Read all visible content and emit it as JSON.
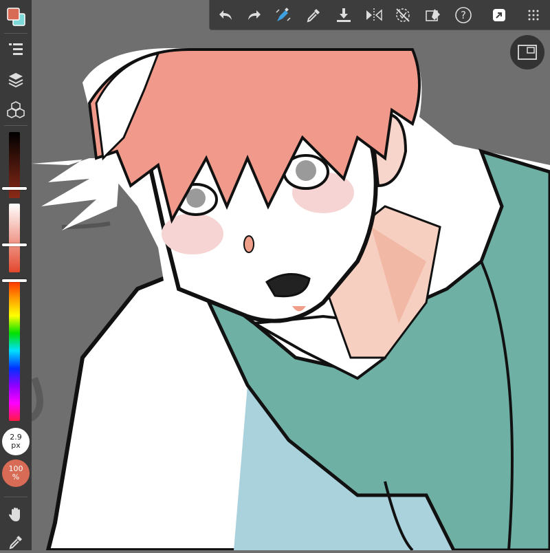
{
  "app": {
    "accent_color": "#d86b55",
    "secondary_color": "#7fd8d8"
  },
  "left_toolbar": {
    "items": [
      {
        "name": "color-swatch",
        "icon": "primary-secondary-color-swatch"
      },
      {
        "name": "menu",
        "icon": "menu-list-icon"
      },
      {
        "name": "layers",
        "icon": "layers-icon"
      },
      {
        "name": "materials",
        "icon": "cubes-icon"
      }
    ],
    "brush_size": {
      "value": "2.9",
      "unit": "px"
    },
    "brush_opacity": {
      "value": "100",
      "unit": "%"
    },
    "bottom_tools": [
      {
        "name": "hand",
        "icon": "hand-icon"
      },
      {
        "name": "eyedropper",
        "icon": "eyedropper-icon"
      }
    ],
    "sliders": {
      "brightness_level": 0.85,
      "saturation_level": 0.6,
      "hue_level": 0.0
    }
  },
  "top_toolbar": {
    "tools": [
      {
        "name": "undo",
        "icon": "undo-icon"
      },
      {
        "name": "redo",
        "icon": "redo-icon"
      },
      {
        "name": "fill-transform",
        "icon": "pen-transform-icon"
      },
      {
        "name": "eyedropper",
        "icon": "eyedropper-icon"
      },
      {
        "name": "save",
        "icon": "download-save-icon"
      },
      {
        "name": "flip",
        "icon": "flip-horizontal-icon"
      },
      {
        "name": "snap-off",
        "icon": "snap-off-icon"
      },
      {
        "name": "eraser",
        "icon": "eraser-icon"
      },
      {
        "name": "help",
        "icon": "help-icon"
      },
      {
        "name": "share",
        "icon": "share-icon"
      },
      {
        "name": "more",
        "icon": "grid-more-icon"
      }
    ],
    "help_glyph": "?"
  },
  "navigator": {
    "icon": "navigator-window-icon"
  }
}
